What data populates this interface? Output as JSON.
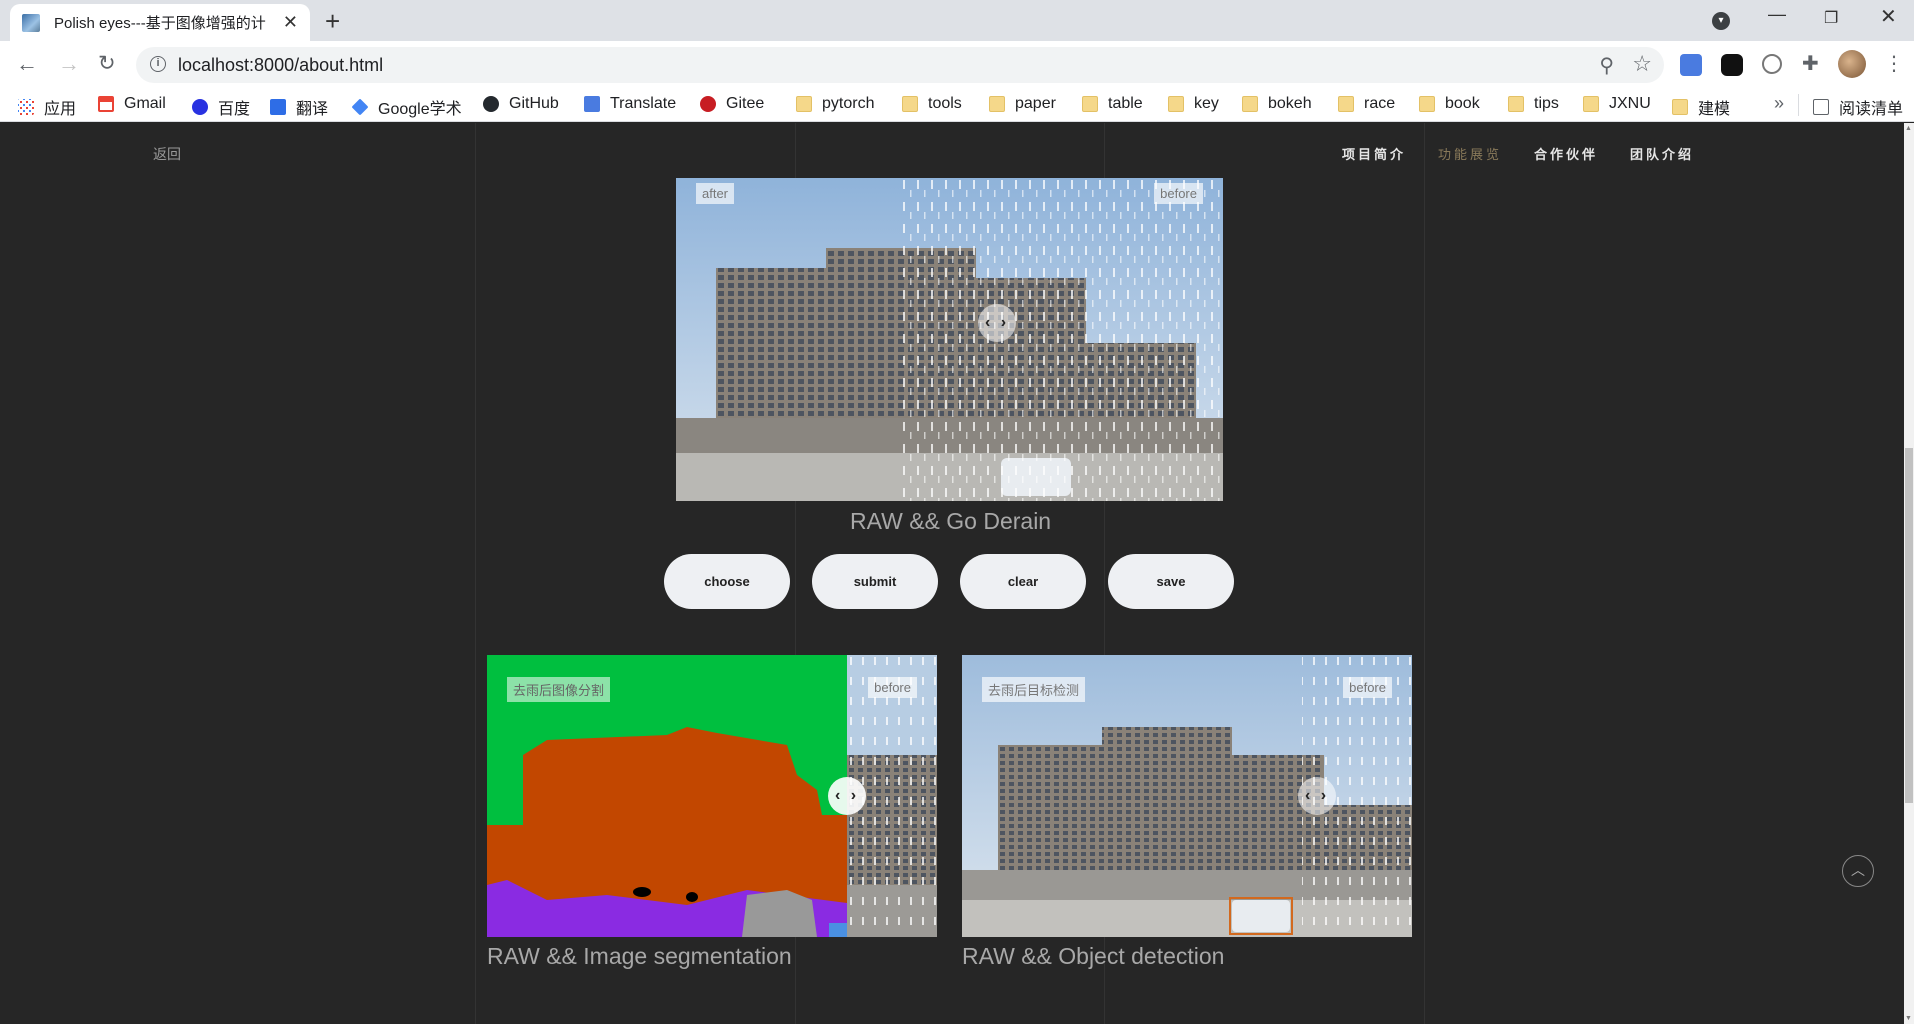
{
  "browser": {
    "tab_title": "Polish eyes---基于图像增强的计",
    "tab_close": "✕",
    "new_tab": "+",
    "url": "localhost:8000/about.html",
    "bookmarks": [
      {
        "label": "应用",
        "icon": "apps-grid-icon"
      },
      {
        "label": "Gmail",
        "icon": "gmail-icon"
      },
      {
        "label": "百度",
        "icon": "baidu-icon"
      },
      {
        "label": "翻译",
        "icon": "translate-cn-icon"
      },
      {
        "label": "Google学术",
        "icon": "scholar-icon"
      },
      {
        "label": "GitHub",
        "icon": "github-icon"
      },
      {
        "label": "Translate",
        "icon": "google-translate-icon"
      },
      {
        "label": "Gitee",
        "icon": "gitee-icon"
      },
      {
        "label": "pytorch",
        "icon": "folder-icon"
      },
      {
        "label": "tools",
        "icon": "folder-icon"
      },
      {
        "label": "paper",
        "icon": "folder-icon"
      },
      {
        "label": "table",
        "icon": "folder-icon"
      },
      {
        "label": "key",
        "icon": "folder-icon"
      },
      {
        "label": "bokeh",
        "icon": "folder-icon"
      },
      {
        "label": "race",
        "icon": "folder-icon"
      },
      {
        "label": "book",
        "icon": "folder-icon"
      },
      {
        "label": "tips",
        "icon": "folder-icon"
      },
      {
        "label": "JXNU",
        "icon": "folder-icon"
      },
      {
        "label": "建模",
        "icon": "folder-icon"
      }
    ],
    "reading_list": "阅读清单",
    "more": "»"
  },
  "nav": {
    "back": "返回",
    "links": [
      {
        "label": "项目简介",
        "active": false
      },
      {
        "label": "功能展览",
        "active": true
      },
      {
        "label": "合作伙伴",
        "active": false
      },
      {
        "label": "团队介绍",
        "active": false
      }
    ]
  },
  "derain": {
    "after_tag": "after",
    "before_tag": "before",
    "caption": "RAW && Go Derain"
  },
  "buttons": {
    "choose": "choose",
    "submit": "submit",
    "clear": "clear",
    "save": "save"
  },
  "segmentation": {
    "tag": "去雨后图像分割",
    "before_tag": "before",
    "caption": "RAW && Image segmentation"
  },
  "detection": {
    "tag": "去雨后目标检测",
    "before_tag": "before",
    "caption": "RAW && Object detection"
  },
  "handle_glyph": "‹ ›",
  "to_top": "︿"
}
